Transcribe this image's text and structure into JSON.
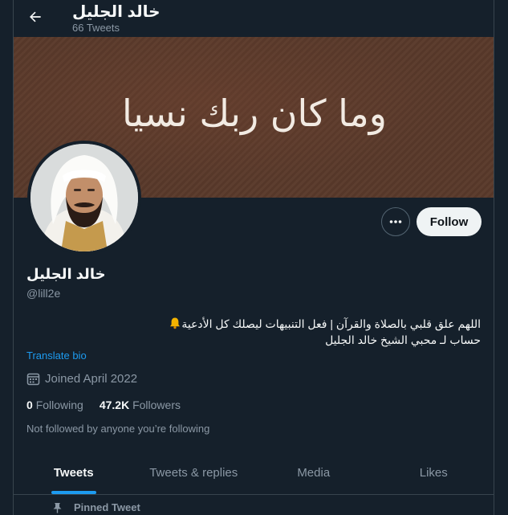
{
  "header": {
    "title": "خالد الجليل",
    "tweet_count": "66 Tweets"
  },
  "banner": {
    "text": "وما كان ربك نسيا"
  },
  "actions": {
    "more": "•••",
    "follow": "Follow"
  },
  "profile": {
    "name": "خالد الجليل",
    "handle": "@lill2e",
    "bio_line1": "اللهم علق قلبي بالصلاة والقرآن | فعل التنبيهات ليصلك كل الأدعية",
    "bio_line2": "حساب لـ محبي الشيخ خالد الجليل",
    "translate": "Translate bio",
    "joined": "Joined April 2022",
    "following_count": "0",
    "following_label": "Following",
    "followers_count": "47.2K",
    "followers_label": "Followers",
    "not_followed": "Not followed by anyone you’re following"
  },
  "tabs": [
    {
      "label": "Tweets"
    },
    {
      "label": "Tweets & replies"
    },
    {
      "label": "Media"
    },
    {
      "label": "Likes"
    }
  ],
  "pinned": {
    "label": "Pinned Tweet"
  },
  "colors": {
    "background": "#15202b",
    "accent": "#1d9bf0",
    "secondary_text": "#8b98a5"
  }
}
